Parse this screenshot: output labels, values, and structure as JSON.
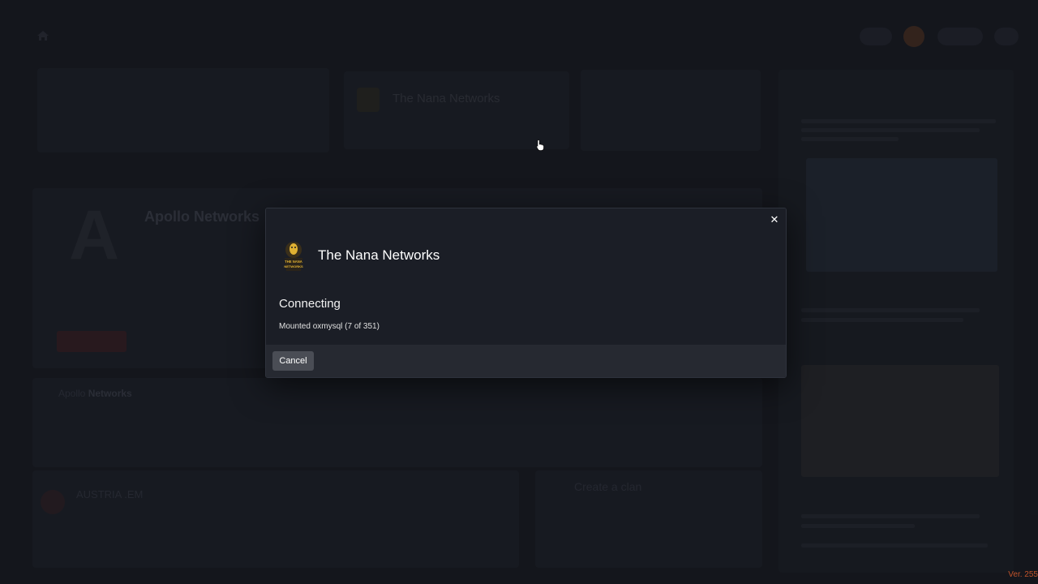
{
  "modal": {
    "server_name": "The Nana Networks",
    "logo_text": "THE NANA NETWORKS",
    "status_title": "Connecting",
    "status_detail": "Mounted oxmysql (7 of 351)",
    "cancel_label": "Cancel",
    "close_glyph": "✕"
  },
  "background": {
    "server_card_name": "The Nana Networks",
    "featured_server_title": "Apollo Networks",
    "lower_section_title_prefix": "Apollo",
    "lower_section_title_bold": "Networks",
    "friend_name": "AUSTRIA .EM",
    "create_clan_label": "Create a clan"
  },
  "footer": {
    "version": "Ver. 255"
  },
  "colors": {
    "modal_bg": "#1b1e26",
    "modal_footer_bg": "#262931",
    "cancel_button_bg": "#4a4d55",
    "version_text": "#c0532a"
  }
}
